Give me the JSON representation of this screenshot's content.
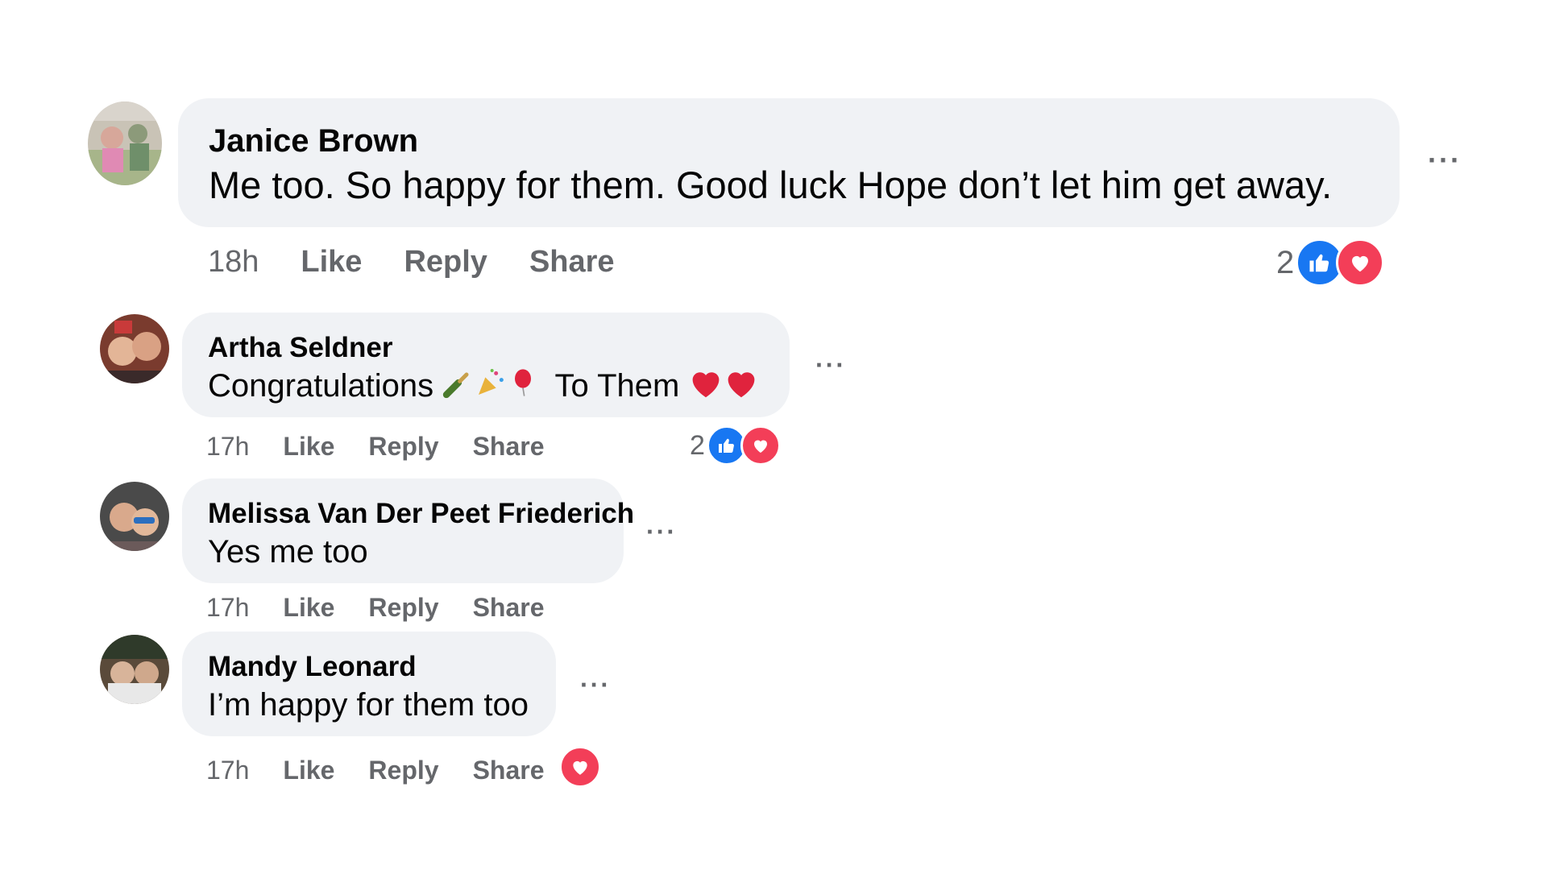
{
  "comments": [
    {
      "author": "Janice Brown",
      "text": "Me too. So happy for them. Good luck Hope don’t let him get away.",
      "time": "18h",
      "actions": {
        "like": "Like",
        "reply": "Reply",
        "share": "Share"
      },
      "reaction_count": "2",
      "reactions": [
        "like-icon",
        "love-icon"
      ]
    },
    {
      "author": "Artha Seldner",
      "text_before": "Congratulations",
      "text_after": "To Them",
      "emojis": [
        "bottle-emoji",
        "party-popper-emoji",
        "balloon-emoji"
      ],
      "trailing_emojis": [
        "red-heart-emoji",
        "red-heart-emoji"
      ],
      "time": "17h",
      "actions": {
        "like": "Like",
        "reply": "Reply",
        "share": "Share"
      },
      "reaction_count": "2",
      "reactions": [
        "like-icon",
        "love-icon"
      ]
    },
    {
      "author": "Melissa Van Der Peet Friederich",
      "text": "Yes me too",
      "time": "17h",
      "actions": {
        "like": "Like",
        "reply": "Reply",
        "share": "Share"
      }
    },
    {
      "author": "Mandy Leonard",
      "text": "I’m happy for them too",
      "time": "17h",
      "actions": {
        "like": "Like",
        "reply": "Reply",
        "share": "Share"
      },
      "reactions": [
        "love-icon"
      ]
    }
  ],
  "more_options_label": "···",
  "colors": {
    "bubble": "#f0f2f5",
    "secondary_text": "#65676b",
    "like_blue": "#1877f2",
    "love_red": "#f33e58"
  }
}
